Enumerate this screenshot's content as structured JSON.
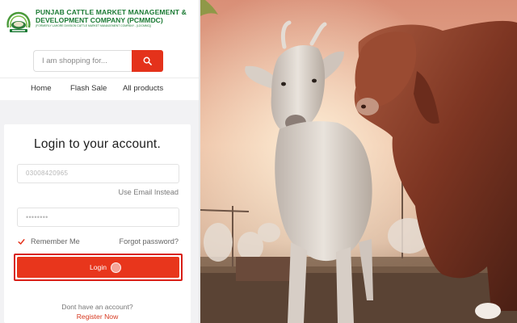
{
  "brand": {
    "line1": "PUNJAB CATTLE MARKET MANAGEMENT &",
    "line2": "DEVELOPMENT COMPANY (PCMMDC)",
    "line3": "(FORMERLY LAHORE DIVISION CATTLE MARKET MANAGEMENT COMPANY - (LDCMMC))"
  },
  "search": {
    "placeholder": "I am shopping for...",
    "button_icon": "search-icon"
  },
  "nav": {
    "items": [
      {
        "label": "Home"
      },
      {
        "label": "Flash Sale"
      },
      {
        "label": "All products"
      }
    ]
  },
  "login": {
    "title": "Login to your account.",
    "phone_value": "03008420965",
    "email_instead": "Use Email Instead",
    "password_value": "••••••••",
    "remember_label": "Remember Me",
    "remember_checked": true,
    "forgot_label": "Forgot password?",
    "button_label": "Login",
    "no_account": "Dont have an account?",
    "register_label": "Register Now"
  },
  "colors": {
    "brand_green": "#1b7a34",
    "accent_red": "#e4321b"
  },
  "photo": {
    "subject": "goat-and-brahman-bull-photo"
  }
}
